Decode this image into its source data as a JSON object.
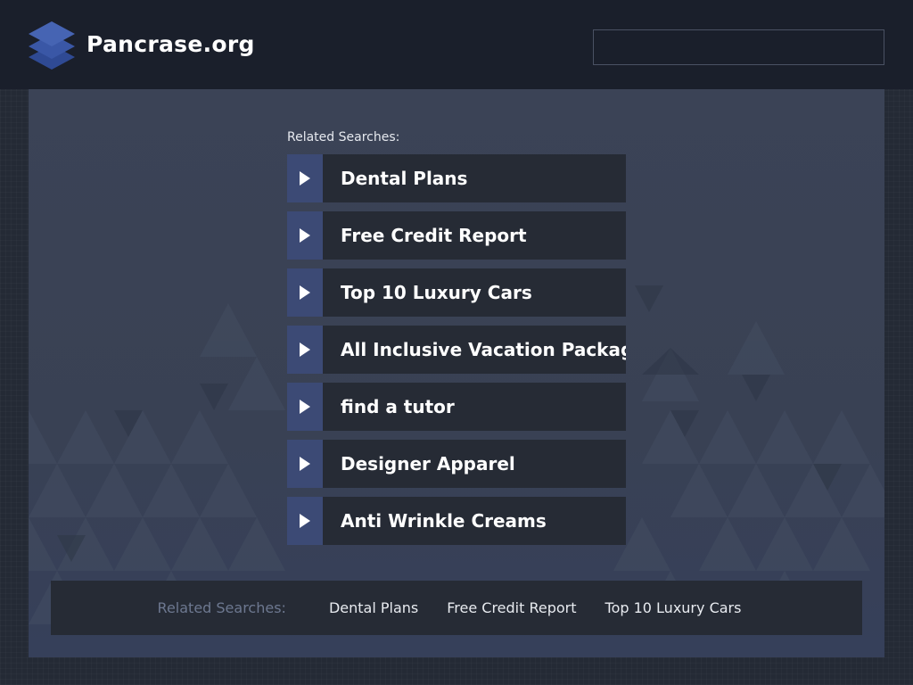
{
  "header": {
    "site_title": "Pancrase.org",
    "logo_icon": "layered-stack-icon",
    "search_value": "",
    "search_placeholder": ""
  },
  "main": {
    "related_label": "Related Searches:",
    "results": [
      {
        "label": "Dental Plans"
      },
      {
        "label": "Free Credit Report"
      },
      {
        "label": "Top 10 Luxury Cars"
      },
      {
        "label": "All Inclusive Vacation Packages"
      },
      {
        "label": "find a tutor"
      },
      {
        "label": "Designer Apparel"
      },
      {
        "label": "Anti Wrinkle Creams"
      }
    ]
  },
  "footer": {
    "label": "Related Searches:",
    "links": [
      {
        "label": "Dental Plans"
      },
      {
        "label": "Free Credit Report"
      },
      {
        "label": "Top 10 Luxury Cars"
      }
    ]
  },
  "colors": {
    "header_bg": "#1a1f2b",
    "content_bg": "#3b4356",
    "arrow_block": "#3c4a75",
    "result_bg": "#262b35",
    "logo_blue": "#3f5aa8"
  }
}
